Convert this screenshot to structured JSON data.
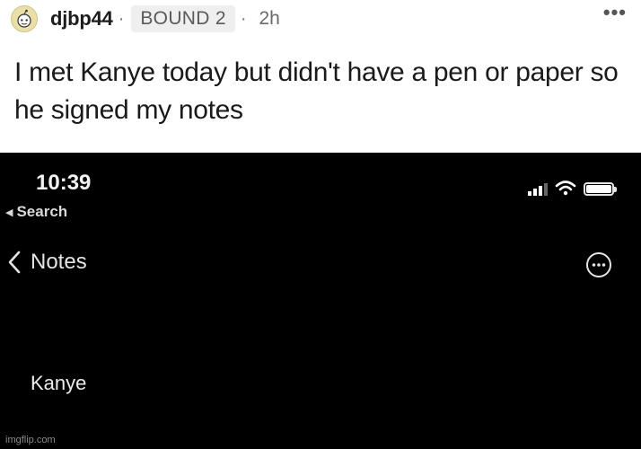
{
  "post": {
    "username": "djbp44",
    "separator": "·",
    "flair": "BOUND 2",
    "time_separator": "·",
    "time": "2h",
    "more_menu": "•••",
    "title": "I met Kanye today but didn't have a pen or paper so he signed my notes"
  },
  "phone": {
    "status_bar": {
      "time": "10:39",
      "back_label": "Search",
      "icons": [
        "cellular-signal-icon",
        "wifi-icon",
        "battery-icon"
      ]
    },
    "nav": {
      "back_label": "Notes",
      "back_icon": "chevron-left-icon",
      "options_icon": "ellipsis-circle-icon"
    },
    "note": {
      "text": "Kanye"
    }
  },
  "watermark": "imgflip.com"
}
